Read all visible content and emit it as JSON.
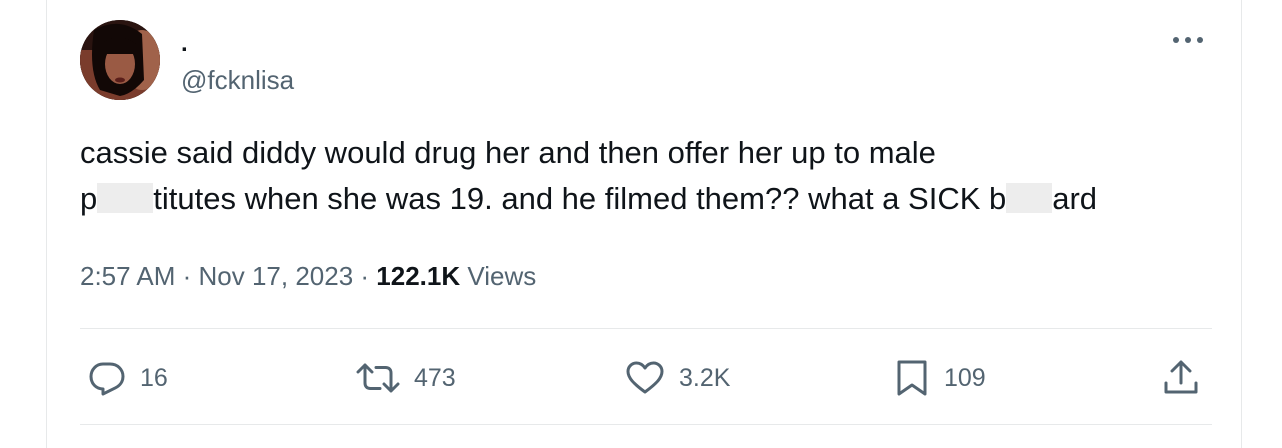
{
  "user": {
    "display_name": ".",
    "handle": "@fcknlisa"
  },
  "tweet": {
    "line1": "cassie said diddy would drug her and then offer her up to male",
    "line2_a": "p",
    "line2_b": "titutes when she was 19. and he filmed them?? what a SICK b",
    "line2_c": "ard"
  },
  "meta": {
    "time": "2:57 AM",
    "sep1": " · ",
    "date": "Nov 17, 2023",
    "sep2": " · ",
    "views_count": "122.1K",
    "views_label": " Views"
  },
  "actions": {
    "replies": "16",
    "reposts": "473",
    "likes": "3.2K",
    "bookmarks": "109"
  },
  "icons": {
    "more": "more-horizontal-icon",
    "reply": "reply-bubble-icon",
    "repost": "repost-arrows-icon",
    "like": "heart-icon",
    "bookmark": "bookmark-icon",
    "share": "share-upload-icon"
  },
  "colors": {
    "text_primary": "#0f1419",
    "text_secondary": "#536471",
    "divider": "#e7e9ea"
  }
}
